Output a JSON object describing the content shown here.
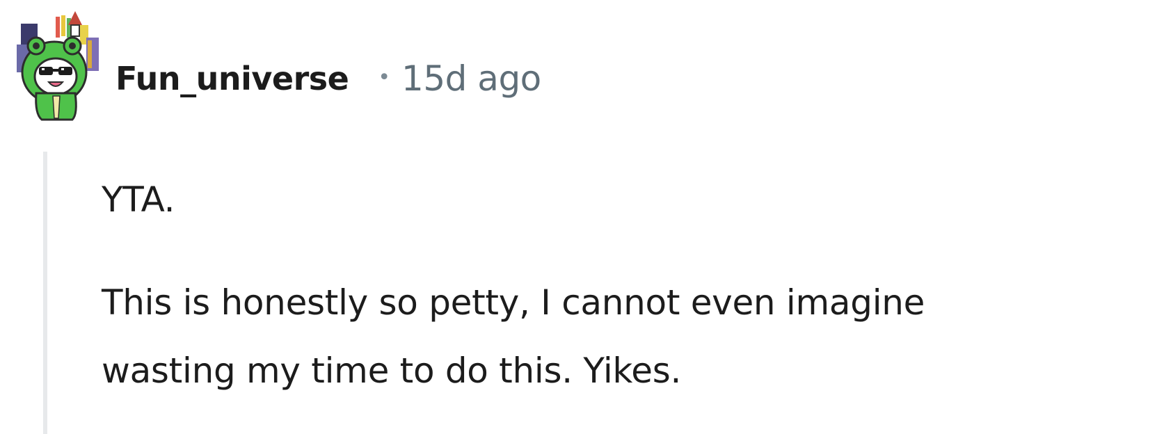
{
  "comment": {
    "author": "Fun_universe",
    "separator": "•",
    "timestamp": "15d ago",
    "avatar_icon": "frog-hood-snoo-avatar-icon",
    "body": {
      "paragraph_1": "YTA.",
      "paragraph_2_line_1": "This is honestly so petty, I cannot even imagine",
      "paragraph_2_line_2": "wasting my time to do this. Yikes."
    }
  },
  "colors": {
    "text": "#1c1c1c",
    "meta": "#5f6e78",
    "thread_line": "#e7e9eb",
    "avatar_green": "#4fc24a"
  }
}
